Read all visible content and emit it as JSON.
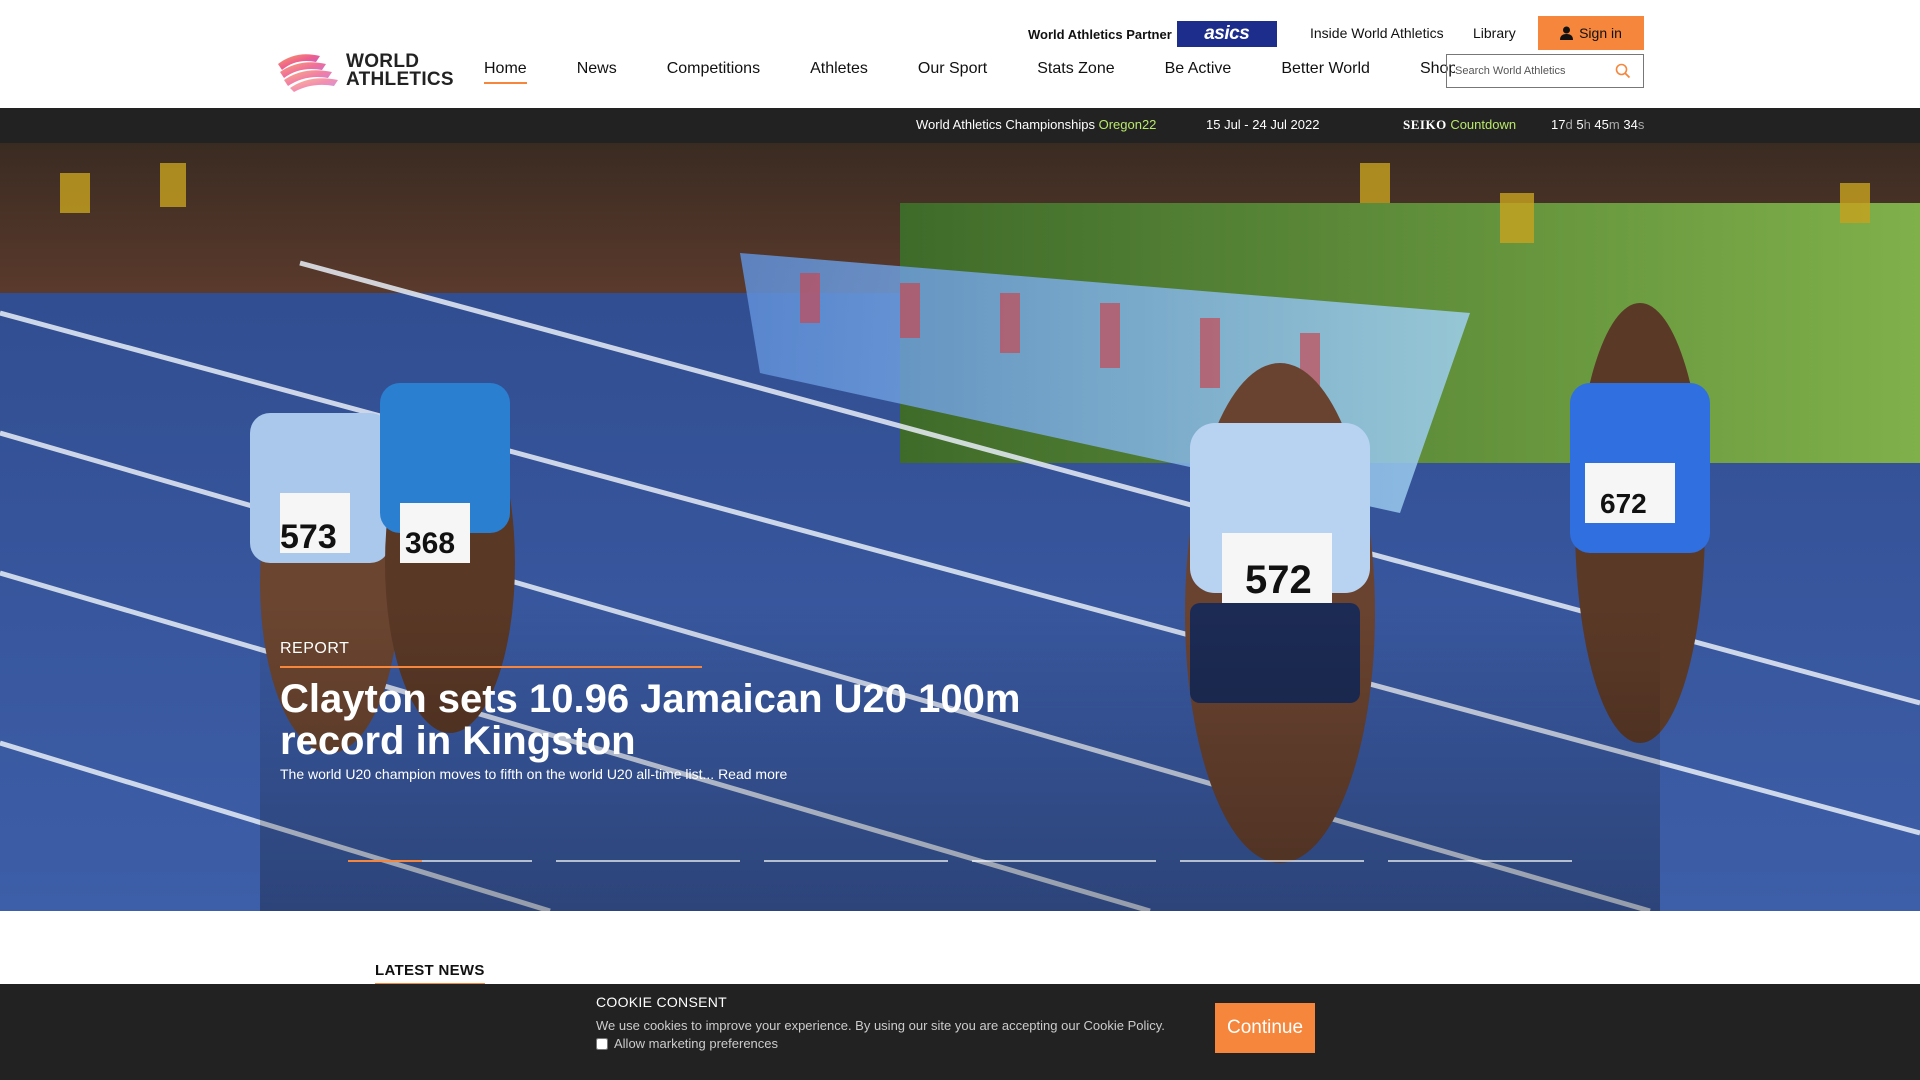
{
  "header": {
    "logo_line1": "WORLD",
    "logo_line2": "ATHLETICS",
    "partner_label": "World Athletics Partner",
    "partner_brand": "asics",
    "links": [
      "Inside World Athletics",
      "Library"
    ],
    "signin_label": "Sign in",
    "nav": [
      "Home",
      "News",
      "Competitions",
      "Athletes",
      "Our Sport",
      "Stats Zone",
      "Be Active",
      "Better World",
      "Shop"
    ],
    "active_nav": "Home",
    "search_placeholder": "Search World Athletics"
  },
  "countdown_bar": {
    "event_name": "World Athletics Championships",
    "event_highlight": "Oregon22",
    "dates": "15 Jul - 24 Jul 2022",
    "sponsor": "SEIKO",
    "countdown_label": "Countdown",
    "days": "17",
    "days_unit": "d",
    "hours": "5",
    "hours_unit": "h",
    "minutes": "45",
    "minutes_unit": "m",
    "seconds": "34",
    "seconds_unit": "s"
  },
  "hero": {
    "tag": "REPORT",
    "title": "Clayton sets 10.96 Jamaican U20 100m record in Kingston",
    "subtitle": "The world U20 champion moves to fifth on the world U20 all-time list... Read more",
    "bibs": [
      "573",
      "368",
      "572",
      "672"
    ],
    "slides": [
      {
        "progress": 0.4
      },
      {
        "progress": 0
      },
      {
        "progress": 0
      },
      {
        "progress": 0
      },
      {
        "progress": 0
      },
      {
        "progress": 0
      }
    ]
  },
  "latest_news": {
    "heading": "LATEST NEWS"
  },
  "cookie": {
    "title": "COOKIE CONSENT",
    "text": "We use cookies to improve your experience. By using our site you are accepting our Cookie Policy.",
    "checkbox_label": "Allow marketing preferences",
    "button_label": "Continue"
  },
  "colors": {
    "accent": "#f5863c",
    "dark_bar": "#222222",
    "asics": "#1d2d8c",
    "highlight_green": "#b9e86a"
  }
}
